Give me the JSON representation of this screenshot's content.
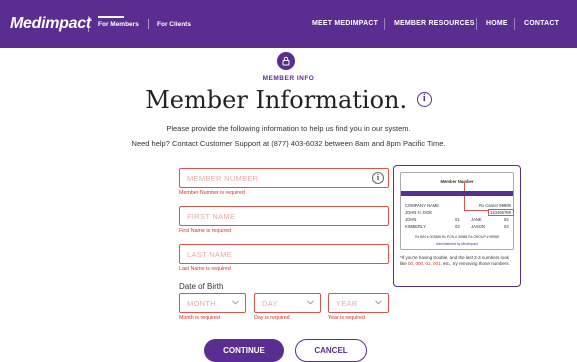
{
  "header": {
    "logo": "Medimpact",
    "audience_tabs": [
      "For Members",
      "For Clients"
    ],
    "nav": [
      "MEET MEDIMPACT",
      "MEMBER RESOURCES",
      "HOME",
      "CONTACT"
    ],
    "colors": {
      "brand": "#5a2d91",
      "error": "#d0342c"
    }
  },
  "section": {
    "icon": "lock-icon",
    "label": "MEMBER INFO",
    "title": "Member Information.",
    "intro": "Please provide the following information to help us find you in our system.",
    "help": "Need help? Contact Customer Support at (877) 403-6032 between 8am and 8pm Pacific Time."
  },
  "form": {
    "member_number": {
      "placeholder": "MEMBER NUMBER",
      "error": "Member Number is required"
    },
    "first_name": {
      "placeholder": "FIRST NAME",
      "error": "First Name is required"
    },
    "last_name": {
      "placeholder": "LAST NAME",
      "error": "Last Name is required"
    },
    "dob_label": "Date of Birth",
    "month": {
      "placeholder": "MONTH",
      "error": "Month is required"
    },
    "day": {
      "placeholder": "DAY",
      "error": "Day is required"
    },
    "year": {
      "placeholder": "YEAR",
      "error": "Year is required"
    }
  },
  "card": {
    "heading": "Member Number",
    "rows": [
      [
        "COMPANY NAME",
        "",
        "Rx Carrier 99999"
      ],
      [
        "JOHN H. DOE",
        "",
        "123456789"
      ],
      [
        "JOHN",
        "01",
        "JANE",
        "02"
      ],
      [
        "KIMBERLY",
        "03",
        "JASON",
        "04"
      ]
    ],
    "footer": "Rx BIN # 003585   Rx PCN # 39988   Rx GROUP # 99988",
    "admin": "Administered by Medimpact",
    "note_prefix": "*If you're having trouble, and the last 2-3 numbers look like ",
    "note_red": "00, 000, 01, 001",
    "note_suffix": ", etc., try removing those numbers."
  },
  "actions": {
    "continue": "CONTINUE",
    "cancel": "CANCEL"
  }
}
